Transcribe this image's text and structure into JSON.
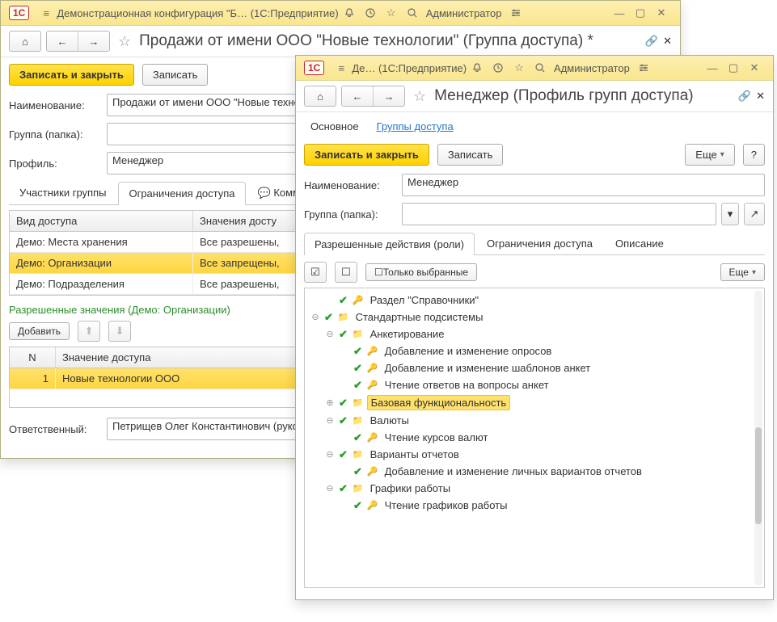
{
  "win1": {
    "title": "Демонстрационная конфигурация \"Б…",
    "subtitle": "(1С:Предприятие)",
    "user": "Администратор",
    "page_title": "Продажи от имени ООО \"Новые технологии\" (Группа доступа) *",
    "buttons": {
      "save_close": "Записать и закрыть",
      "save": "Записать"
    },
    "fields": {
      "name_label": "Наименование:",
      "name_value": "Продажи от имени ООО \"Новые технол",
      "group_label": "Группа (папка):",
      "group_value": "",
      "profile_label": "Профиль:",
      "profile_value": "Менеджер",
      "resp_label": "Ответственный:",
      "resp_value": "Петрищев Олег Константинович (руково"
    },
    "tabs": {
      "t1": "Участники группы",
      "t2": "Ограничения доступа",
      "t3": "Комм"
    },
    "access_table": {
      "col1": "Вид доступа",
      "col2": "Значения досту",
      "rows": [
        {
          "c1": "Демо: Места хранения",
          "c2": "Все разрешены,"
        },
        {
          "c1": "Демо: Организации",
          "c2": "Все запрещены,"
        },
        {
          "c1": "Демо: Подразделения",
          "c2": "Все разрешены,"
        }
      ]
    },
    "allowed_header": "Разрешенные значения (Демо: Организации)",
    "add_btn": "Добавить",
    "val_table": {
      "colN": "N",
      "colV": "Значение доступа",
      "rN": "1",
      "rV": "Новые технологии ООО"
    }
  },
  "win2": {
    "title": "Де…",
    "subtitle": "(1С:Предприятие)",
    "user": "Администратор",
    "page_title": "Менеджер (Профиль групп доступа)",
    "navtabs": {
      "main": "Основное",
      "groups": "Группы доступа"
    },
    "buttons": {
      "save_close": "Записать и закрыть",
      "save": "Записать",
      "more": "Еще"
    },
    "fields": {
      "name_label": "Наименование:",
      "name_value": "Менеджер",
      "group_label": "Группа (папка):",
      "group_value": ""
    },
    "tabs": {
      "t1": "Разрешенные действия (роли)",
      "t2": "Ограничения доступа",
      "t3": "Описание"
    },
    "toolbar": {
      "only_selected": "Только выбранные",
      "more": "Еще"
    },
    "tree": {
      "n0": "Раздел \"Справочники\"",
      "n1": "Стандартные подсистемы",
      "n2": "Анкетирование",
      "n2a": "Добавление и изменение опросов",
      "n2b": "Добавление и изменение шаблонов анкет",
      "n2c": "Чтение ответов на вопросы анкет",
      "n3": "Базовая функциональность",
      "n4": "Валюты",
      "n4a": "Чтение курсов валют",
      "n5": "Варианты отчетов",
      "n5a": "Добавление и изменение личных вариантов отчетов",
      "n6": "Графики работы",
      "n6a": "Чтение графиков работы"
    }
  }
}
